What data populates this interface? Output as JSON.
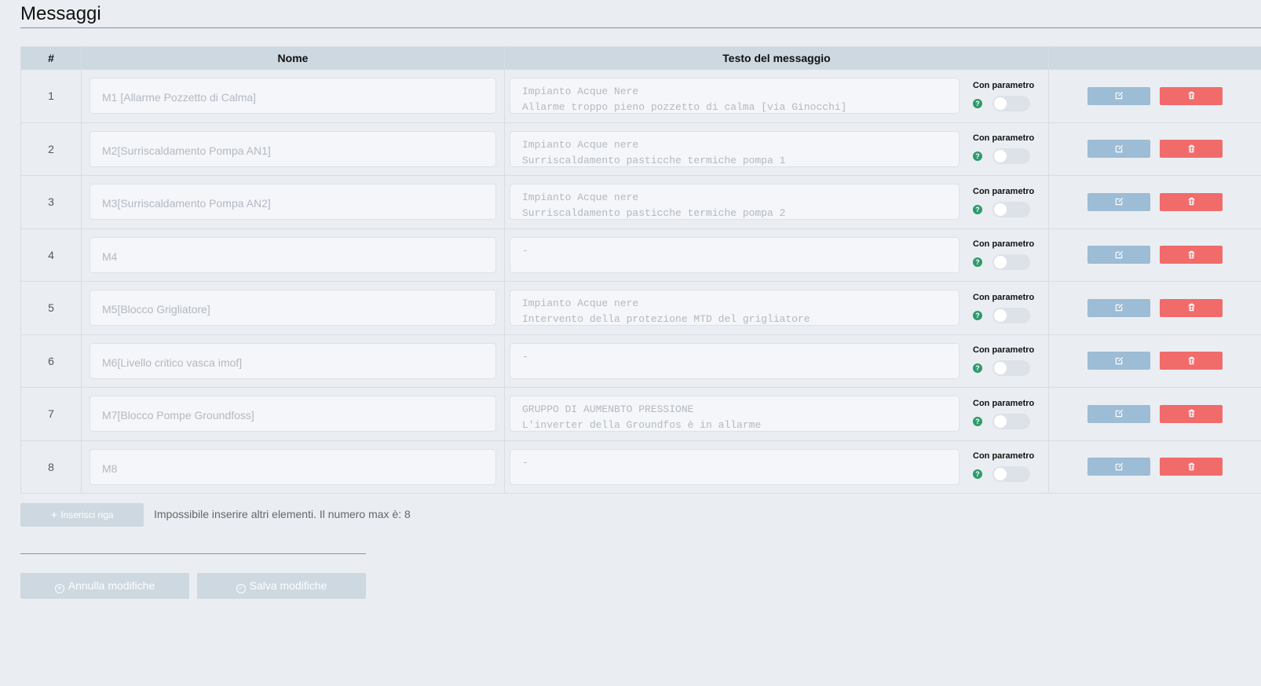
{
  "page": {
    "title": "Messaggi"
  },
  "table": {
    "headers": {
      "num": "#",
      "name": "Nome",
      "text": "Testo del messaggio",
      "actions": ""
    },
    "param_label": "Con parametro",
    "rows": [
      {
        "num": "1",
        "name": "M1 [Allarme Pozzetto di Calma]",
        "text": "Impianto Acque Nere\nAllarme troppo pieno pozzetto di calma [via Ginocchi]",
        "param_enabled": false
      },
      {
        "num": "2",
        "name": "M2[Surriscaldamento Pompa AN1]",
        "text": "Impianto Acque nere\nSurriscaldamento pasticche termiche pompa 1",
        "param_enabled": false
      },
      {
        "num": "3",
        "name": "M3[Surriscaldamento Pompa AN2]",
        "text": "Impianto Acque nere\nSurriscaldamento pasticche termiche pompa 2",
        "param_enabled": false
      },
      {
        "num": "4",
        "name": "M4",
        "text": "-",
        "param_enabled": false
      },
      {
        "num": "5",
        "name": "M5[Blocco Grigliatore]",
        "text": "Impianto Acque nere\nIntervento della protezione MTD del grigliatore",
        "param_enabled": false
      },
      {
        "num": "6",
        "name": "M6[Livello critico vasca imof]",
        "text": "-",
        "param_enabled": false
      },
      {
        "num": "7",
        "name": "M7[Blocco Pompe Groundfoss]",
        "text": "GRUPPO DI AUMENBTO PRESSIONE\nL'inverter della Groundfos è in allarme",
        "param_enabled": false
      },
      {
        "num": "8",
        "name": "M8",
        "text": "-",
        "param_enabled": false
      }
    ]
  },
  "actions": {
    "add_row_label": "Inserisci riga",
    "max_message": "Impossibile inserire altri elementi. Il numero max è: 8",
    "cancel_label": "Annulla modifiche",
    "save_label": "Salva modifiche"
  },
  "colors": {
    "background": "#eaeef2",
    "header_bg": "#cdd8e0",
    "edit_button": "#9dbcd5",
    "delete_button": "#f16b6b",
    "help_icon": "#2e9a6b"
  },
  "icons": {
    "edit": "edit-icon",
    "delete": "trash-icon",
    "help": "question-icon",
    "add": "plus-icon",
    "cancel": "circle-x-icon",
    "save": "circle-check-icon"
  }
}
